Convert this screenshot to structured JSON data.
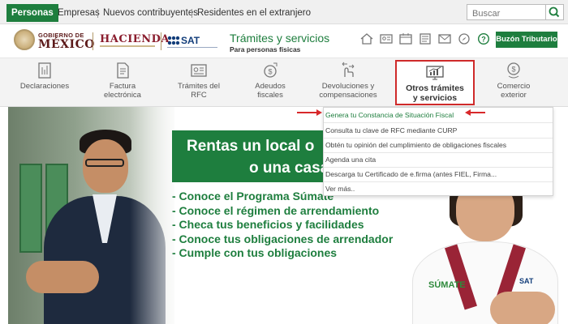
{
  "topbar": {
    "tabs": [
      "Personas",
      "Empresas",
      "Nuevos contribuyentes",
      "Residentes en el extranjero"
    ],
    "search_placeholder": "Buscar"
  },
  "header": {
    "gob_line1": "GOBIERNO DE",
    "gob_line2": "MÉXICO",
    "hacienda": "HACIENDA",
    "sat": "SAT",
    "service_title": "Trámites y servicios",
    "service_subtitle": "Para personas físicas",
    "icons": [
      "home-icon",
      "id-card-icon",
      "calendar-icon",
      "document-icon",
      "mail-icon",
      "compass-icon",
      "help-icon"
    ],
    "buzon_label": "Buzón Tributario"
  },
  "nav": {
    "items": [
      {
        "label": "Declaraciones",
        "icon": "declaraciones-icon"
      },
      {
        "label": "Factura\nelectrónica",
        "icon": "invoice-icon"
      },
      {
        "label": "Trámites del\nRFC",
        "icon": "rfc-card-icon"
      },
      {
        "label": "Adeudos\nfiscales",
        "icon": "debts-icon"
      },
      {
        "label": "Devoluciones y\ncompensaciones",
        "icon": "refund-icon"
      },
      {
        "label": "Otros trámites\ny servicios",
        "icon": "chart-monitor-icon"
      },
      {
        "label": "Comercio\nexterior",
        "icon": "foreign-trade-icon"
      }
    ],
    "active_index": 5
  },
  "dropdown": {
    "items": [
      "Genera tu Constancia de Situación Fiscal",
      "Consulta tu clave de RFC mediante CURP",
      "Obtén tu opinión del cumplimiento de obligaciones fiscales",
      "Agenda una cita",
      "Descarga tu Certificado de e.firma (antes FIEL, Firma...",
      "Ver más.."
    ]
  },
  "hero": {
    "banner_line1": "Rentas un local o",
    "banner_line2": "o una casa",
    "bullets": [
      "- Conoce el Programa Súmate",
      "- Conoce el régimen de arrendamiento",
      "- Checa tus beneficios y facilidades",
      "- Conoce tus obligaciones de arrendador",
      "- Cumple con tus obligaciones"
    ],
    "shirt_logo": "SÚMATE",
    "shirt_sat": "SAT"
  },
  "colors": {
    "brand_green": "#1e7e3e",
    "highlight_red": "#cf2a2a",
    "gobierno_maroon": "#5c1a1a",
    "sat_blue": "#123d7a"
  }
}
